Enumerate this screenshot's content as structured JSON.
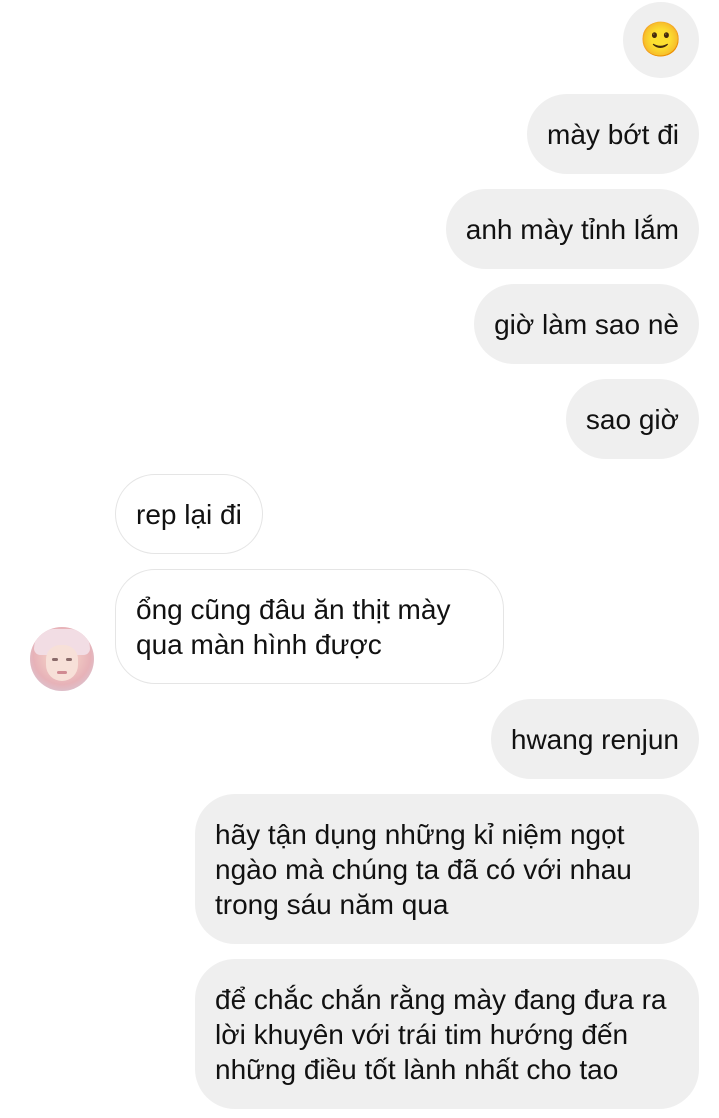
{
  "conversation": {
    "messages": [
      {
        "side": "sent",
        "text": "🙂"
      },
      {
        "side": "sent",
        "text": "mày bớt đi"
      },
      {
        "side": "sent",
        "text": "anh mày tỉnh lắm"
      },
      {
        "side": "sent",
        "text": "giờ làm sao nè"
      },
      {
        "side": "sent",
        "text": "sao giờ"
      },
      {
        "side": "received",
        "text": "rep lại đi"
      },
      {
        "side": "received",
        "text": "ổng cũng đâu ăn thịt mày qua màn hình được"
      },
      {
        "side": "sent",
        "text": "hwang renjun"
      },
      {
        "side": "sent",
        "text": "hãy tận dụng những kỉ niệm ngọt ngào mà chúng ta đã có với nhau trong sáu năm qua"
      },
      {
        "side": "sent",
        "text": "để chắc chắn rằng mày đang đưa ra lời khuyên với trái tim hướng đến những điều tốt lành nhất cho tao"
      }
    ]
  },
  "colors": {
    "sent_bubble": "#efefef",
    "received_bubble": "#ffffff",
    "received_border": "#e5e5e5",
    "text": "#111111"
  },
  "icons": {
    "emoji": "slightly-smiling-face-emoji",
    "avatar": "contact-avatar"
  }
}
